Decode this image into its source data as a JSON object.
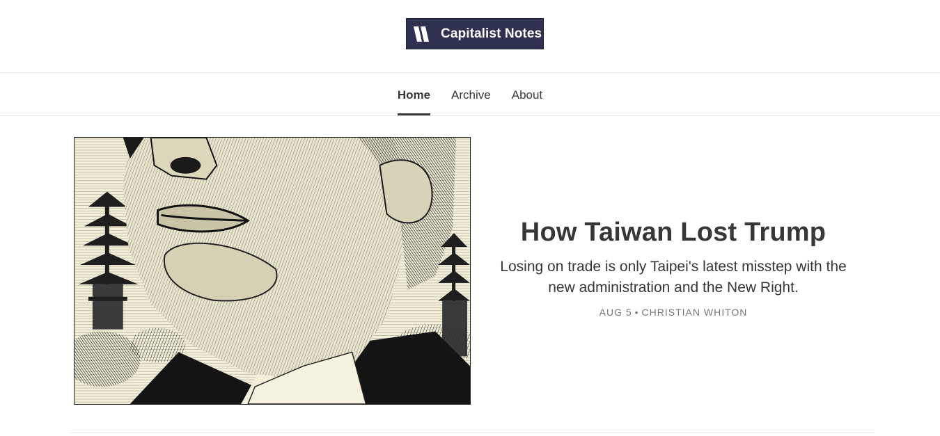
{
  "header": {
    "logo_text": "Capitalist Notes",
    "logo_icon": "stripes-logo-mark",
    "brand_color": "#2e3150"
  },
  "nav": {
    "tabs": [
      {
        "label": "Home",
        "active": true
      },
      {
        "label": "Archive",
        "active": false
      },
      {
        "label": "About",
        "active": false
      }
    ]
  },
  "featured_post": {
    "title": "How Taiwan Lost Trump",
    "subtitle": "Losing on trade is only Taipei's latest misstep with the new administration and the New Right.",
    "date": "AUG 5",
    "separator": "•",
    "author": "CHRISTIAN WHITON"
  }
}
